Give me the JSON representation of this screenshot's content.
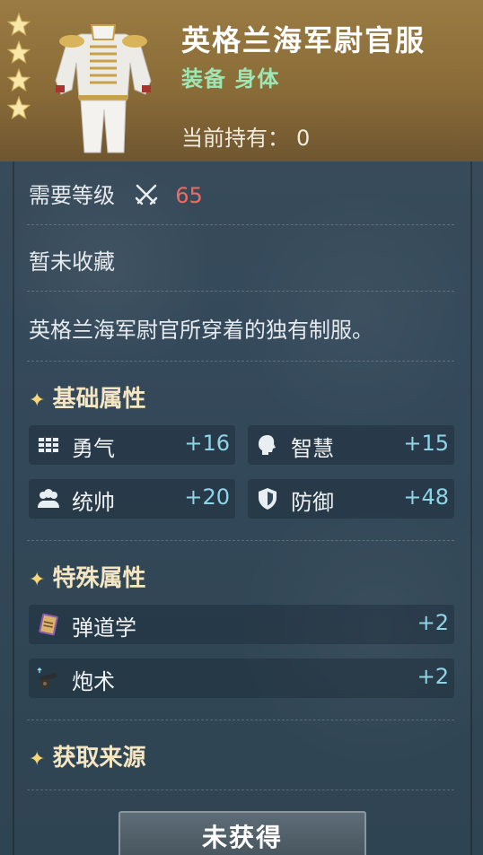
{
  "item": {
    "name": "英格兰海军尉官服",
    "category": "装备 身体",
    "owned_label": "当前持有：",
    "owned_value": "0",
    "stars": 4
  },
  "requirement": {
    "label": "需要等级",
    "value": "65",
    "value_color": "#f06a62"
  },
  "collection_status": "暂未收藏",
  "description": "英格兰海军尉官所穿着的独有制服。",
  "basic_attributes": {
    "title": "基础属性",
    "items": [
      {
        "icon": "courage-icon",
        "label": "勇气",
        "value": "+16"
      },
      {
        "icon": "wisdom-icon",
        "label": "智慧",
        "value": "+15"
      },
      {
        "icon": "leadership-icon",
        "label": "统帅",
        "value": "+20"
      },
      {
        "icon": "defense-icon",
        "label": "防御",
        "value": "+48"
      }
    ]
  },
  "special_attributes": {
    "title": "特殊属性",
    "items": [
      {
        "icon": "ballistics-book-icon",
        "label": "弹道学",
        "value": "+2"
      },
      {
        "icon": "cannon-icon",
        "label": "炮术",
        "value": "+2"
      }
    ]
  },
  "source": {
    "title": "获取来源"
  },
  "action_button": "未获得",
  "colors": {
    "header_gold": "#9a7b43",
    "category_green": "#9fe6b4",
    "attr_value_blue": "#8fd5e8",
    "section_gold": "#f4e6c2"
  }
}
